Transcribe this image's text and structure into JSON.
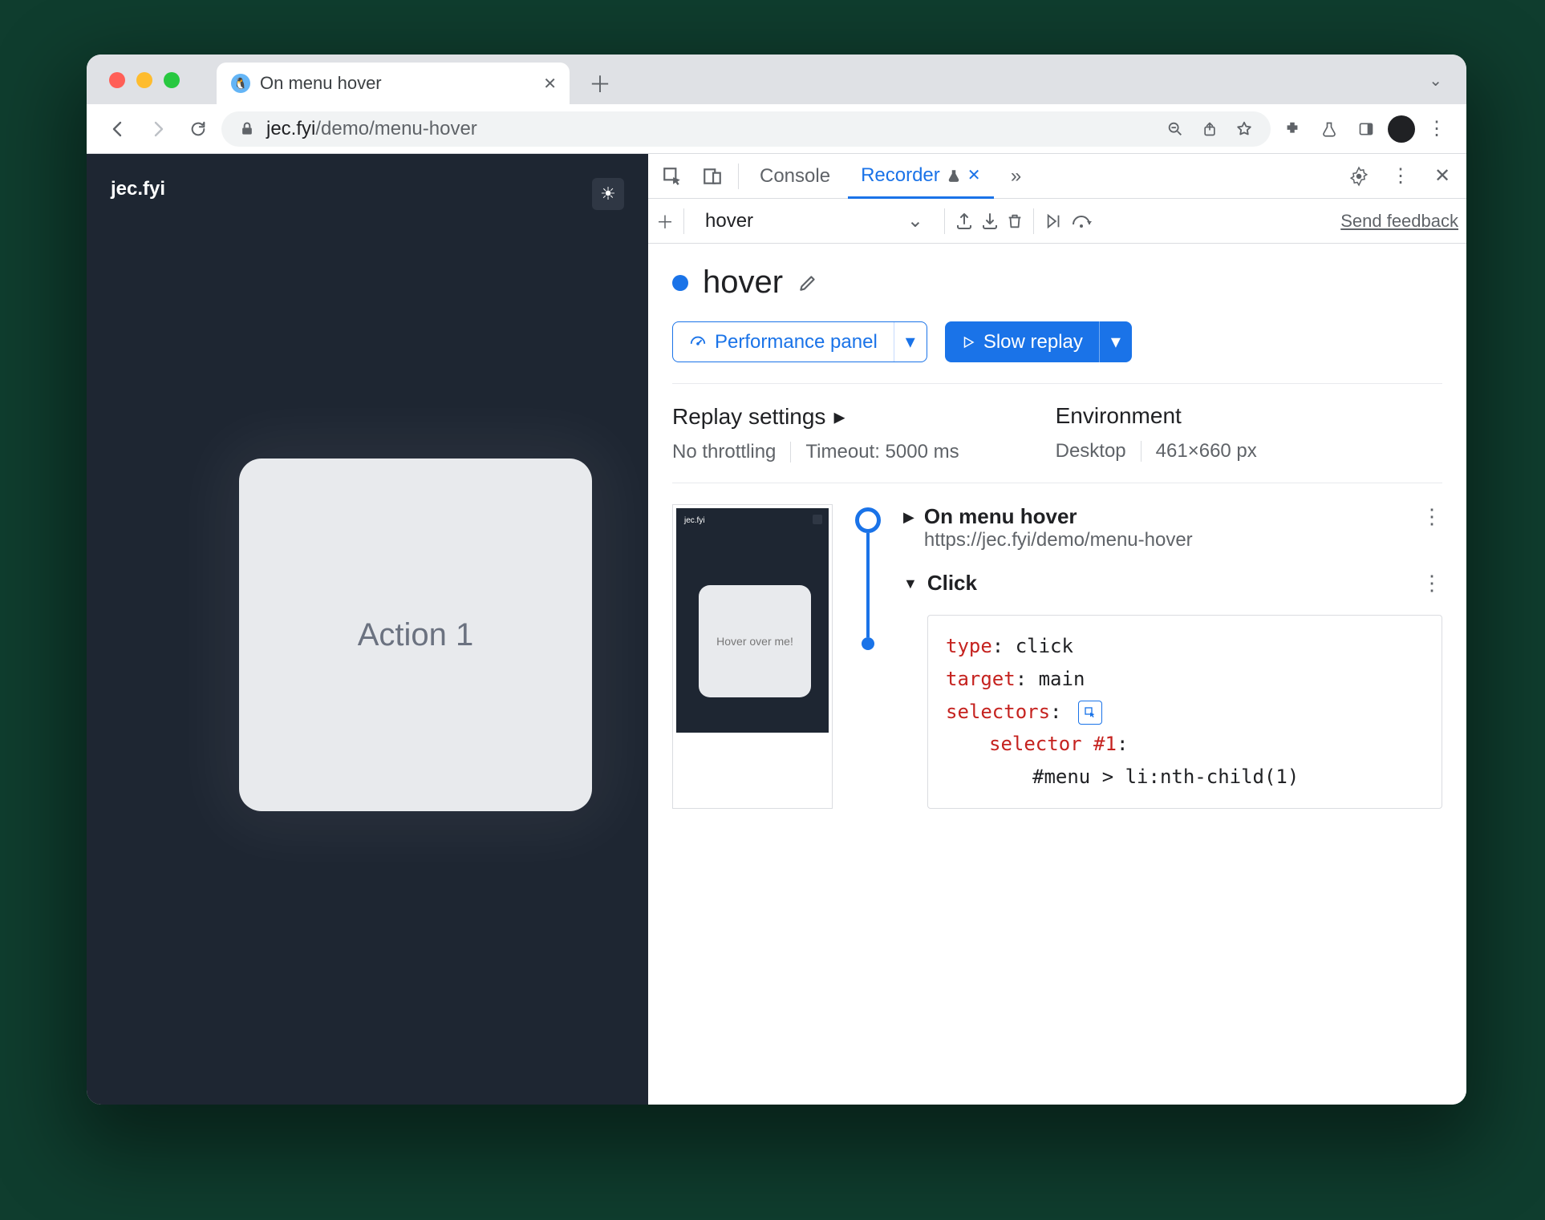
{
  "browser": {
    "tab_title": "On menu hover",
    "url_host": "jec.fyi",
    "url_path": "/demo/menu-hover"
  },
  "page": {
    "brand": "jec.fyi",
    "card_text": "Action 1"
  },
  "devtools": {
    "tabs": {
      "console": "Console",
      "recorder": "Recorder"
    },
    "toolbar": {
      "dropdown_value": "hover",
      "feedback": "Send feedback"
    },
    "recording": {
      "title": "hover",
      "perf_button": "Performance panel",
      "replay_button": "Slow replay"
    },
    "settings": {
      "replay_title": "Replay settings",
      "throttling": "No throttling",
      "timeout": "Timeout: 5000 ms",
      "env_title": "Environment",
      "env_device": "Desktop",
      "env_size": "461×660 px"
    },
    "steps": {
      "thumb_text": "Hover over me!",
      "nav_title": "On menu hover",
      "nav_url": "https://jec.fyi/demo/menu-hover",
      "click_title": "Click",
      "code": {
        "k_type": "type",
        "v_type": "click",
        "k_target": "target",
        "v_target": "main",
        "k_selectors": "selectors",
        "k_selector1": "selector #1",
        "v_selector1": "#menu > li:nth-child(1)"
      }
    }
  }
}
